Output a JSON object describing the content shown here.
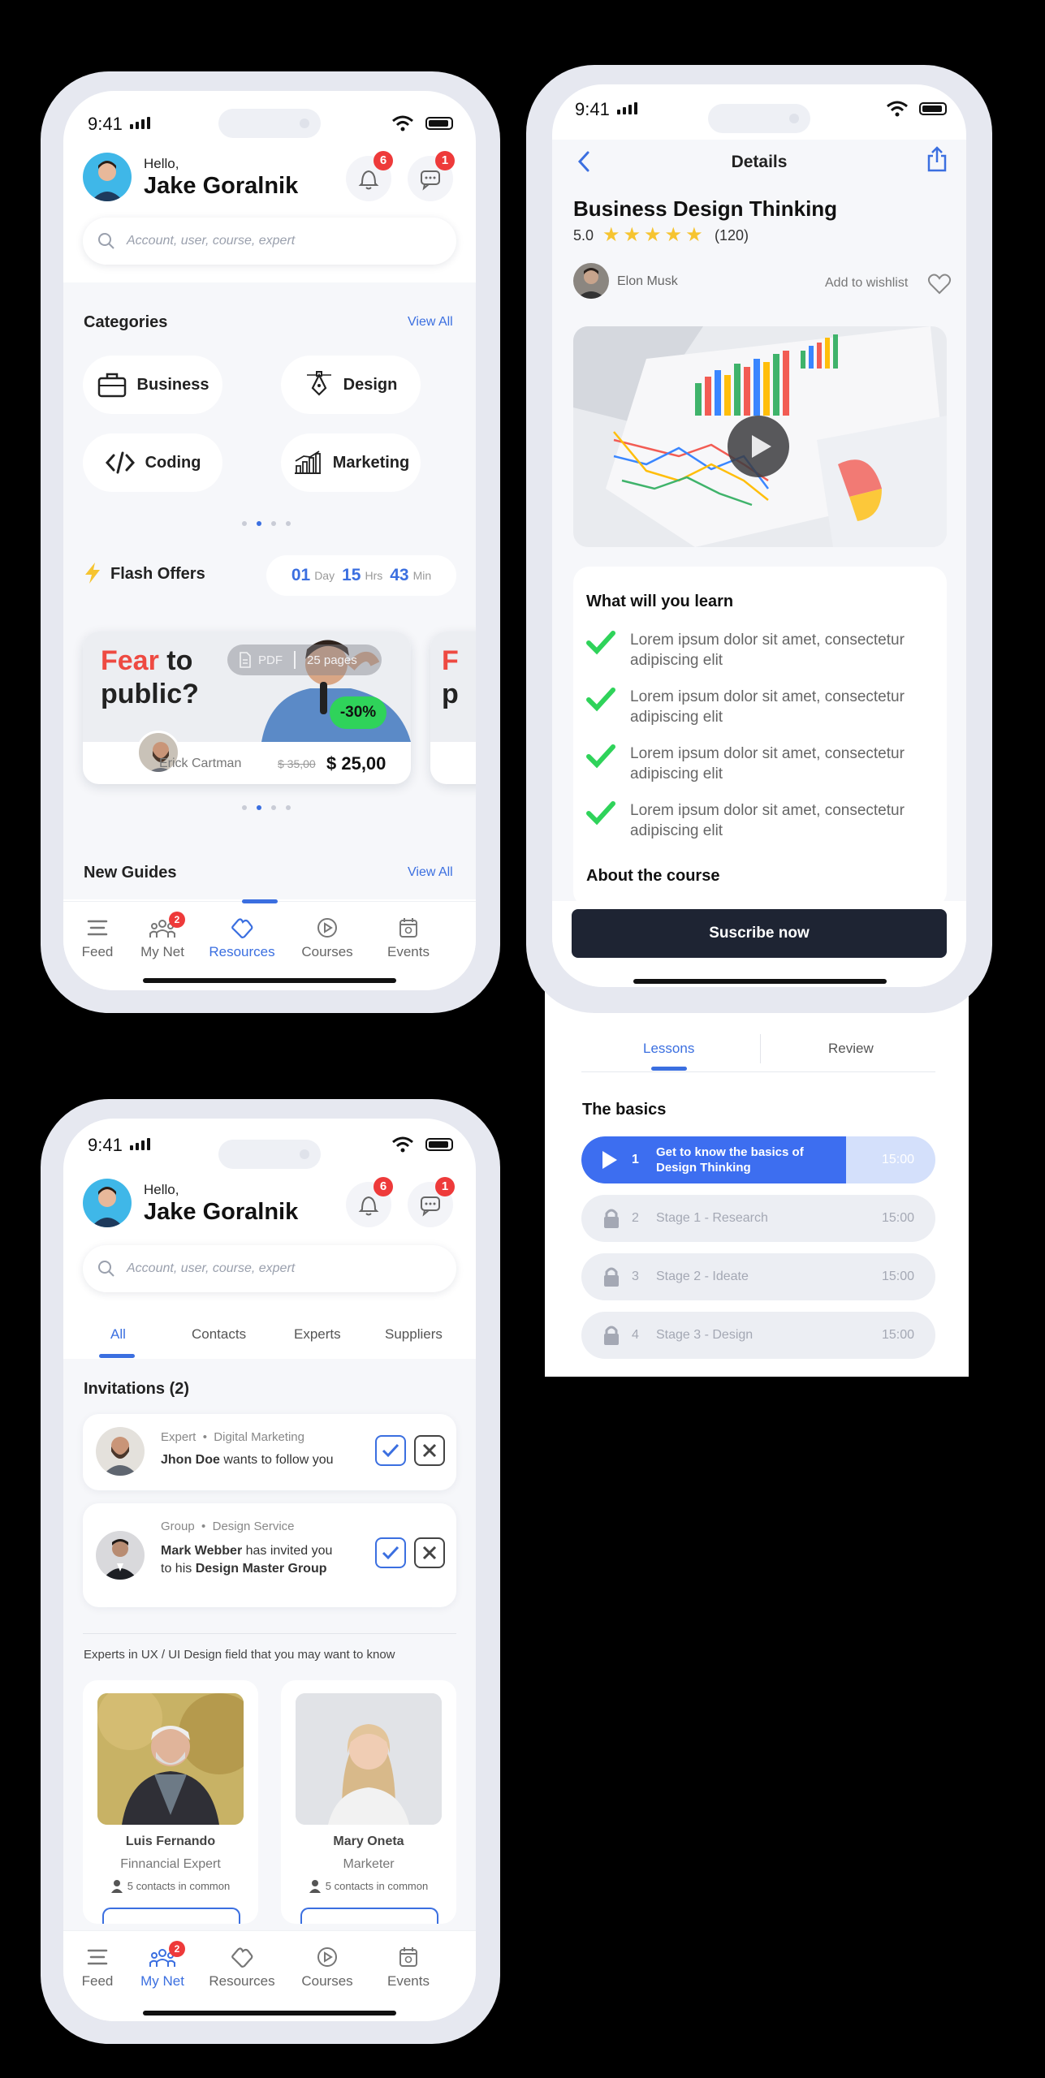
{
  "status": {
    "time": "9:41"
  },
  "home": {
    "greeting": "Hello,",
    "user_name": "Jake Goralnik",
    "notif_count": "6",
    "msg_count": "1",
    "search_placeholder": "Account, user, course, expert",
    "categories_title": "Categories",
    "view_all": "View All",
    "categories": [
      {
        "label": "Business",
        "icon": "briefcase-icon"
      },
      {
        "label": "Design",
        "icon": "pen-tool-icon"
      },
      {
        "label": "Coding",
        "icon": "code-icon"
      },
      {
        "label": "Marketing",
        "icon": "chart-icon"
      }
    ],
    "flash_title": "Flash Offers",
    "timer": {
      "days": "01",
      "day_label": "Day",
      "hours": "15",
      "hrs_label": "Hrs",
      "mins": "43",
      "min_label": "Min"
    },
    "offer": {
      "title_red": "Fear",
      "title_rest1": " to",
      "title_rest2": "public?",
      "type": "PDF",
      "pages": "25 pages",
      "discount": "-30%",
      "author": "Erick Cartman",
      "old_price": "$ 35,00",
      "price": "$ 25,00"
    },
    "new_guides_title": "New Guides",
    "view_all_2": "View All",
    "nav": [
      "Feed",
      "My Net",
      "Resources",
      "Courses",
      "Events"
    ],
    "nav_badge": "2",
    "active_nav": "Resources"
  },
  "details": {
    "header_title": "Details",
    "course_title": "Business Design Thinking",
    "rating": "5.0",
    "rating_count": "(120)",
    "author": "Elon Musk",
    "wishlist": "Add to wishlist",
    "learn_title": "What will you learn",
    "learn_items": [
      "Lorem ipsum dolor sit amet, consectetur adipiscing elit",
      "Lorem ipsum dolor sit amet, consectetur adipiscing elit",
      "Lorem ipsum dolor sit amet, consectetur adipiscing elit",
      "Lorem ipsum dolor sit amet, consectetur adipiscing elit"
    ],
    "about_title": "About the course",
    "subscribe": "Suscribe now",
    "tabs": [
      "Lessons",
      "Review"
    ],
    "basics_title": "The basics",
    "lessons": [
      {
        "num": "1",
        "title": "Get to know the basics of Design Thinking",
        "time": "15:00"
      },
      {
        "num": "2",
        "title": "Stage 1 - Research",
        "time": "15:00"
      },
      {
        "num": "3",
        "title": "Stage 2 - Ideate",
        "time": "15:00"
      },
      {
        "num": "4",
        "title": "Stage 3 - Design",
        "time": "15:00"
      }
    ]
  },
  "network": {
    "greeting": "Hello,",
    "user_name": "Jake Goralnik",
    "notif_count": "6",
    "msg_count": "1",
    "search_placeholder": "Account, user, course, expert",
    "tabs": [
      "All",
      "Contacts",
      "Experts",
      "Suppliers"
    ],
    "invitations_title": "Invitations (2)",
    "invites": [
      {
        "meta1": "Expert",
        "meta2": "Digital Marketing",
        "name": "Jhon Doe",
        "text": " wants to follow you"
      },
      {
        "meta1": "Group",
        "meta2": "Design Service",
        "name": "Mark Webber",
        "text": " has invited you",
        "line2a": "to his ",
        "group": "Design Master Group"
      }
    ],
    "experts_caption": "Experts in UX / UI Design field that you may want to know",
    "experts": [
      {
        "name": "Luis Fernando",
        "role": "Finnancial Expert",
        "contacts": "5 contacts in common"
      },
      {
        "name": "Mary Oneta",
        "role": "Marketer",
        "contacts": "5 contacts in common"
      }
    ],
    "nav": [
      "Feed",
      "My Net",
      "Resources",
      "Courses",
      "Events"
    ],
    "nav_badge": "2",
    "active_nav": "My Net"
  },
  "colors": {
    "accent": "#3b6fe0",
    "danger": "#ee3a3a",
    "success": "#2fd35a",
    "star": "#f6c430",
    "dark_button": "#1e2433"
  }
}
